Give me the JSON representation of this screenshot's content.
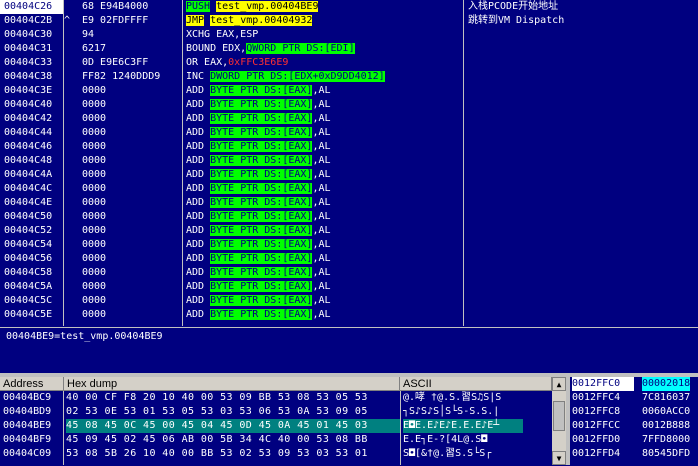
{
  "disasm": {
    "rows": [
      {
        "addr": "00404C26",
        "jmp": "",
        "hex": "68 E94B4000",
        "pre": "",
        "op": "PUSH",
        "mid": " ",
        "operand": "test_vmp.00404BE9",
        "post": "",
        "op_style": "green",
        "operand_style": "yellow",
        "comment": "入栈PCODE开始地址",
        "selected": true
      },
      {
        "addr": "00404C2B",
        "jmp": "^",
        "hex": "E9 02FDFFFF",
        "pre": "",
        "op": "JMP",
        "mid": " ",
        "operand": "test_vmp.00404932",
        "post": "",
        "op_style": "yellow",
        "operand_style": "yellow",
        "comment": "跳转到VM Dispatch",
        "selected": false
      },
      {
        "addr": "00404C30",
        "jmp": "",
        "hex": "94",
        "pre": "XCHG EAX,ESP",
        "op": "",
        "mid": "",
        "operand": "",
        "post": "",
        "op_style": "",
        "operand_style": "",
        "comment": "",
        "selected": false
      },
      {
        "addr": "00404C31",
        "jmp": "",
        "hex": "6217",
        "pre": "BOUND EDX,",
        "op": "",
        "mid": "",
        "operand": "QWORD PTR DS:[EDI]",
        "post": "",
        "op_style": "",
        "operand_style": "green",
        "comment": "",
        "selected": false
      },
      {
        "addr": "00404C33",
        "jmp": "",
        "hex": "0D E9E6C3FF",
        "pre": "OR EAX,",
        "op": "",
        "mid": "",
        "operand": "0xFFC3E6E9",
        "post": "",
        "op_style": "",
        "operand_style": "red",
        "comment": "",
        "selected": false
      },
      {
        "addr": "00404C38",
        "jmp": "",
        "hex": "FF82 1240DDD9",
        "pre": "INC ",
        "op": "",
        "mid": "",
        "operand": "DWORD PTR DS:[EDX+0xD9DD4012]",
        "post": "",
        "op_style": "",
        "operand_style": "green",
        "comment": "",
        "selected": false
      },
      {
        "addr": "00404C3E",
        "jmp": "",
        "hex": "0000",
        "pre": "ADD ",
        "op": "",
        "mid": "",
        "operand": "BYTE PTR DS:[EAX]",
        "post": ",AL",
        "op_style": "",
        "operand_style": "green",
        "comment": "",
        "selected": false
      },
      {
        "addr": "00404C40",
        "jmp": "",
        "hex": "0000",
        "pre": "ADD ",
        "op": "",
        "mid": "",
        "operand": "BYTE PTR DS:[EAX]",
        "post": ",AL",
        "op_style": "",
        "operand_style": "green",
        "comment": "",
        "selected": false
      },
      {
        "addr": "00404C42",
        "jmp": "",
        "hex": "0000",
        "pre": "ADD ",
        "op": "",
        "mid": "",
        "operand": "BYTE PTR DS:[EAX]",
        "post": ",AL",
        "op_style": "",
        "operand_style": "green",
        "comment": "",
        "selected": false
      },
      {
        "addr": "00404C44",
        "jmp": "",
        "hex": "0000",
        "pre": "ADD ",
        "op": "",
        "mid": "",
        "operand": "BYTE PTR DS:[EAX]",
        "post": ",AL",
        "op_style": "",
        "operand_style": "green",
        "comment": "",
        "selected": false
      },
      {
        "addr": "00404C46",
        "jmp": "",
        "hex": "0000",
        "pre": "ADD ",
        "op": "",
        "mid": "",
        "operand": "BYTE PTR DS:[EAX]",
        "post": ",AL",
        "op_style": "",
        "operand_style": "green",
        "comment": "",
        "selected": false
      },
      {
        "addr": "00404C48",
        "jmp": "",
        "hex": "0000",
        "pre": "ADD ",
        "op": "",
        "mid": "",
        "operand": "BYTE PTR DS:[EAX]",
        "post": ",AL",
        "op_style": "",
        "operand_style": "green",
        "comment": "",
        "selected": false
      },
      {
        "addr": "00404C4A",
        "jmp": "",
        "hex": "0000",
        "pre": "ADD ",
        "op": "",
        "mid": "",
        "operand": "BYTE PTR DS:[EAX]",
        "post": ",AL",
        "op_style": "",
        "operand_style": "green",
        "comment": "",
        "selected": false
      },
      {
        "addr": "00404C4C",
        "jmp": "",
        "hex": "0000",
        "pre": "ADD ",
        "op": "",
        "mid": "",
        "operand": "BYTE PTR DS:[EAX]",
        "post": ",AL",
        "op_style": "",
        "operand_style": "green",
        "comment": "",
        "selected": false
      },
      {
        "addr": "00404C4E",
        "jmp": "",
        "hex": "0000",
        "pre": "ADD ",
        "op": "",
        "mid": "",
        "operand": "BYTE PTR DS:[EAX]",
        "post": ",AL",
        "op_style": "",
        "operand_style": "green",
        "comment": "",
        "selected": false
      },
      {
        "addr": "00404C50",
        "jmp": "",
        "hex": "0000",
        "pre": "ADD ",
        "op": "",
        "mid": "",
        "operand": "BYTE PTR DS:[EAX]",
        "post": ",AL",
        "op_style": "",
        "operand_style": "green",
        "comment": "",
        "selected": false
      },
      {
        "addr": "00404C52",
        "jmp": "",
        "hex": "0000",
        "pre": "ADD ",
        "op": "",
        "mid": "",
        "operand": "BYTE PTR DS:[EAX]",
        "post": ",AL",
        "op_style": "",
        "operand_style": "green",
        "comment": "",
        "selected": false
      },
      {
        "addr": "00404C54",
        "jmp": "",
        "hex": "0000",
        "pre": "ADD ",
        "op": "",
        "mid": "",
        "operand": "BYTE PTR DS:[EAX]",
        "post": ",AL",
        "op_style": "",
        "operand_style": "green",
        "comment": "",
        "selected": false
      },
      {
        "addr": "00404C56",
        "jmp": "",
        "hex": "0000",
        "pre": "ADD ",
        "op": "",
        "mid": "",
        "operand": "BYTE PTR DS:[EAX]",
        "post": ",AL",
        "op_style": "",
        "operand_style": "green",
        "comment": "",
        "selected": false
      },
      {
        "addr": "00404C58",
        "jmp": "",
        "hex": "0000",
        "pre": "ADD ",
        "op": "",
        "mid": "",
        "operand": "BYTE PTR DS:[EAX]",
        "post": ",AL",
        "op_style": "",
        "operand_style": "green",
        "comment": "",
        "selected": false
      },
      {
        "addr": "00404C5A",
        "jmp": "",
        "hex": "0000",
        "pre": "ADD ",
        "op": "",
        "mid": "",
        "operand": "BYTE PTR DS:[EAX]",
        "post": ",AL",
        "op_style": "",
        "operand_style": "green",
        "comment": "",
        "selected": false
      },
      {
        "addr": "00404C5C",
        "jmp": "",
        "hex": "0000",
        "pre": "ADD ",
        "op": "",
        "mid": "",
        "operand": "BYTE PTR DS:[EAX]",
        "post": ",AL",
        "op_style": "",
        "operand_style": "green",
        "comment": "",
        "selected": false
      },
      {
        "addr": "00404C5E",
        "jmp": "",
        "hex": "0000",
        "pre": "ADD ",
        "op": "",
        "mid": "",
        "operand": "BYTE PTR DS:[EAX]",
        "post": ",AL",
        "op_style": "",
        "operand_style": "green",
        "comment": "",
        "selected": false
      }
    ]
  },
  "info": {
    "text": "00404BE9=test_vmp.00404BE9"
  },
  "dump": {
    "headers": {
      "address": "Address",
      "hex": "Hex dump",
      "ascii": "ASCII"
    },
    "rows": [
      {
        "addr": "00404BC9",
        "hex": "40 00 CF F8 20 10 40 00 53 09 BB 53 08 53 05 53",
        "ascii": "@.哮 †@.S.習S♫S|S",
        "selected": false
      },
      {
        "addr": "00404BD9",
        "hex": "02 53 0E 53 01 53 05 53 03 53 06 53 0A 53 09 05",
        "ascii": "┐S♪S♪S│S└S-S.S.|",
        "selected": false
      },
      {
        "addr": "00404BE9",
        "hex": "45 08 45 0C 45 00 45 04 45 0D 45 0A 45 01 45 03",
        "ascii": "E◘E.E♪E♪E.E.E♪E┴",
        "selected": true
      },
      {
        "addr": "00404BF9",
        "hex": "45 09 45 02 45 06 AB 00 5B 34 4C 40 00 53 08 BB",
        "ascii": "E.E┐E-?[4L@.S◘",
        "selected": false
      },
      {
        "addr": "00404C09",
        "hex": "53 08 5B 26 10 40 00 BB 53 02 53 09 53 03 53 01",
        "ascii": "S◘[&†@.習S.S└S┌",
        "selected": false
      }
    ]
  },
  "stack": {
    "rows": [
      {
        "addr": "0012FFC0",
        "val": "00002018",
        "selected": true
      },
      {
        "addr": "0012FFC4",
        "val": "7C816037",
        "selected": false
      },
      {
        "addr": "0012FFC8",
        "val": "0060ACC0",
        "selected": false
      },
      {
        "addr": "0012FFCC",
        "val": "0012B888",
        "selected": false
      },
      {
        "addr": "0012FFD0",
        "val": "7FFD8000",
        "selected": false
      },
      {
        "addr": "0012FFD4",
        "val": "80545DFD",
        "selected": false
      }
    ]
  },
  "colors": {
    "background": "#000080",
    "highlight_yellow": "#ffff00",
    "highlight_green": "#00ff00",
    "selection": "#ffffff",
    "dump_selection": "#008080"
  }
}
